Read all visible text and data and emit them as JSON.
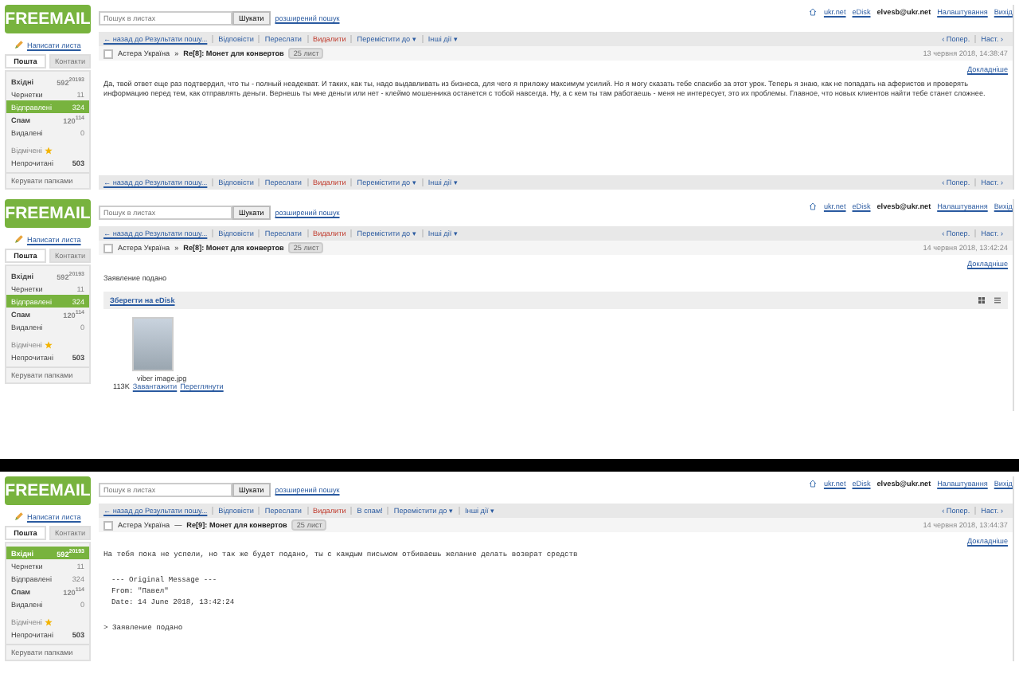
{
  "panels": [
    {
      "sidebar": {
        "logo": "FREEMAIL",
        "compose": "Написати листа",
        "tabs": [
          {
            "label": "Пошта",
            "selected": true
          },
          {
            "label": "Контакти",
            "selected": false
          }
        ],
        "folders": [
          {
            "name": "Вхідні",
            "count": "592",
            "extra": "20193",
            "selected": false,
            "bold": true
          },
          {
            "name": "Чернетки",
            "count": "11",
            "selected": false,
            "bold": false
          },
          {
            "name": "Відправлені",
            "count": "324",
            "selected": true,
            "bold": false
          },
          {
            "name": "Спам",
            "count": "120",
            "extra": "114",
            "selected": false,
            "bold": true
          },
          {
            "name": "Видалені",
            "count": "0",
            "selected": false,
            "bold": false
          }
        ],
        "starred": "Відмічені",
        "unread": "Непрочитані",
        "unread_count": "503",
        "manage": "Керувати папками"
      },
      "header": {
        "search_placeholder": "Пошук в листах",
        "search_button": "Шукати",
        "advanced": "розширений пошук",
        "links": [
          {
            "kind": "home",
            "text": "ukr.net"
          },
          {
            "kind": "link",
            "text": "eDisk"
          },
          {
            "kind": "user",
            "text": "elvesb@ukr.net"
          },
          {
            "kind": "link",
            "text": "Налаштування"
          },
          {
            "kind": "link",
            "text": "Вихід"
          }
        ]
      },
      "toolbar": {
        "items": [
          {
            "kind": "back",
            "text": "← назад до Результати пошу..."
          },
          {
            "kind": "action",
            "text": "Відповісти"
          },
          {
            "kind": "action",
            "text": "Переслати"
          },
          {
            "kind": "danger",
            "text": "Видалити"
          },
          {
            "kind": "menu",
            "text": "Перемістити до ▾"
          },
          {
            "kind": "menu",
            "text": "Інші дії ▾"
          }
        ],
        "prev": "‹ Попер.",
        "next": "Наст. ›"
      },
      "message": {
        "checked": false,
        "sender": "Астера Україна",
        "arrow": "»",
        "subject": "Re[8]: Монет для конвертов",
        "badge": "25 лист",
        "date": "13 червня 2018, 14:38:47",
        "details": "Докладніше",
        "body": [
          {
            "kind": "paragraph",
            "text": "Да, твой ответ еще раз подтвердил, что ты - полный неадекват. И таких, как ты, надо выдавливать из бизнеса, для чего я приложу максимум усилий. Но я могу сказать тебе спасибо за этот урок. Теперь я знаю, как не попадать на аферистов и проверять информацию перед тем, как отправлять деньги. Вернешь ты мне деньги или нет - клеймо мошенника останется с тобой навсегда. Ну, а с кем ты там работаешь - меня не интересует, это их проблемы. Главное, что новых клиентов найти тебе станет сложнее."
          }
        ]
      },
      "bottom_toolbar": {
        "items": [
          {
            "kind": "back",
            "text": "← назад до Результати пошу..."
          },
          {
            "kind": "action",
            "text": "Відповісти"
          },
          {
            "kind": "action",
            "text": "Переслати"
          },
          {
            "kind": "danger",
            "text": "Видалити"
          },
          {
            "kind": "menu",
            "text": "Перемістити до ▾"
          },
          {
            "kind": "menu",
            "text": "Інші дії ▾"
          }
        ],
        "prev": "‹ Попер.",
        "next": "Наст. ›"
      }
    },
    {
      "sidebar": {
        "logo": "FREEMAIL",
        "compose": "Написати листа",
        "tabs": [
          {
            "label": "Пошта",
            "selected": true
          },
          {
            "label": "Контакти",
            "selected": false
          }
        ],
        "folders": [
          {
            "name": "Вхідні",
            "count": "592",
            "extra": "20193",
            "selected": false,
            "bold": true
          },
          {
            "name": "Чернетки",
            "count": "11",
            "selected": false,
            "bold": false
          },
          {
            "name": "Відправлені",
            "count": "324",
            "selected": true,
            "bold": false
          },
          {
            "name": "Спам",
            "count": "120",
            "extra": "114",
            "selected": false,
            "bold": true
          },
          {
            "name": "Видалені",
            "count": "0",
            "selected": false,
            "bold": false
          }
        ],
        "starred": "Відмічені",
        "unread": "Непрочитані",
        "unread_count": "503",
        "manage": "Керувати папками"
      },
      "header": {
        "search_placeholder": "Пошук в листах",
        "search_button": "Шукати",
        "advanced": "розширений пошук",
        "links": [
          {
            "kind": "home",
            "text": "ukr.net"
          },
          {
            "kind": "link",
            "text": "eDisk"
          },
          {
            "kind": "user",
            "text": "elvesb@ukr.net"
          },
          {
            "kind": "link",
            "text": "Налаштування"
          },
          {
            "kind": "link",
            "text": "Вихід"
          }
        ]
      },
      "toolbar": {
        "items": [
          {
            "kind": "back",
            "text": "← назад до Результати пошу..."
          },
          {
            "kind": "action",
            "text": "Відповісти"
          },
          {
            "kind": "action",
            "text": "Переслати"
          },
          {
            "kind": "danger",
            "text": "Видалити"
          },
          {
            "kind": "menu",
            "text": "Перемістити до ▾"
          },
          {
            "kind": "menu",
            "text": "Інші дії ▾"
          }
        ],
        "prev": "‹ Попер.",
        "next": "Наст. ›"
      },
      "message": {
        "checked": false,
        "sender": "Астера Україна",
        "arrow": "»",
        "subject": "Re[8]: Монет для конвертов",
        "badge": "25 лист",
        "date": "14 червня 2018, 13:42:24",
        "details": "Докладніше",
        "body": [
          {
            "kind": "paragraph",
            "text": "Заявление подано"
          },
          {
            "kind": "attachment",
            "save": "Зберегти на eDisk",
            "filename": "viber image.jpg",
            "size": "113K",
            "download": "Завантажити",
            "view": "Переглянути"
          }
        ]
      }
    },
    {
      "sidebar": {
        "logo": "FREEMAIL",
        "compose": "Написати листа",
        "tabs": [
          {
            "label": "Пошта",
            "selected": true
          },
          {
            "label": "Контакти",
            "selected": false
          }
        ],
        "folders": [
          {
            "name": "Вхідні",
            "count": "592",
            "extra": "20193",
            "selected": true,
            "bold": true
          },
          {
            "name": "Чернетки",
            "count": "11",
            "selected": false,
            "bold": false
          },
          {
            "name": "Відправлені",
            "count": "324",
            "selected": false,
            "bold": false
          },
          {
            "name": "Спам",
            "count": "120",
            "extra": "114",
            "selected": false,
            "bold": true
          },
          {
            "name": "Видалені",
            "count": "0",
            "selected": false,
            "bold": false
          }
        ],
        "starred": "Відмічені",
        "unread": "Непрочитані",
        "unread_count": "503",
        "manage": "Керувати папками"
      },
      "header": {
        "search_placeholder": "Пошук в листах",
        "search_button": "Шукати",
        "advanced": "розширений пошук",
        "links": [
          {
            "kind": "home",
            "text": "ukr.net"
          },
          {
            "kind": "link",
            "text": "eDisk"
          },
          {
            "kind": "user",
            "text": "elvesb@ukr.net"
          },
          {
            "kind": "link",
            "text": "Налаштування"
          },
          {
            "kind": "link",
            "text": "Вихід"
          }
        ]
      },
      "toolbar": {
        "items": [
          {
            "kind": "back",
            "text": "← назад до Результати пошу..."
          },
          {
            "kind": "action",
            "text": "Відповісти"
          },
          {
            "kind": "action",
            "text": "Переслати"
          },
          {
            "kind": "danger",
            "text": "Видалити"
          },
          {
            "kind": "action",
            "text": "В спам!"
          },
          {
            "kind": "menu",
            "text": "Перемістити до ▾"
          },
          {
            "kind": "menu",
            "text": "Інші дії ▾"
          }
        ],
        "prev": "‹ Попер.",
        "next": "Наст. ›"
      },
      "message": {
        "checked": false,
        "sender": "Астера Україна",
        "arrow": "—",
        "subject": "Re[9]: Монет для конвертов",
        "badge": "25 лист",
        "date": "14 червня 2018, 13:44:37",
        "details": "Докладніше",
        "body": [
          {
            "kind": "mono",
            "lines": [
              "На тебя пока не успели, но так же будет подано, ты с каждым письмом отбиваешь желание делать возврат средств"
            ]
          },
          {
            "kind": "mono",
            "lines": [
              "--- Original Message ---",
              "From: \"Павел\"",
              "Date: 14 June 2018, 13:42:24"
            ]
          },
          {
            "kind": "mono",
            "lines": [
              "> Заявление подано"
            ]
          }
        ]
      }
    }
  ]
}
